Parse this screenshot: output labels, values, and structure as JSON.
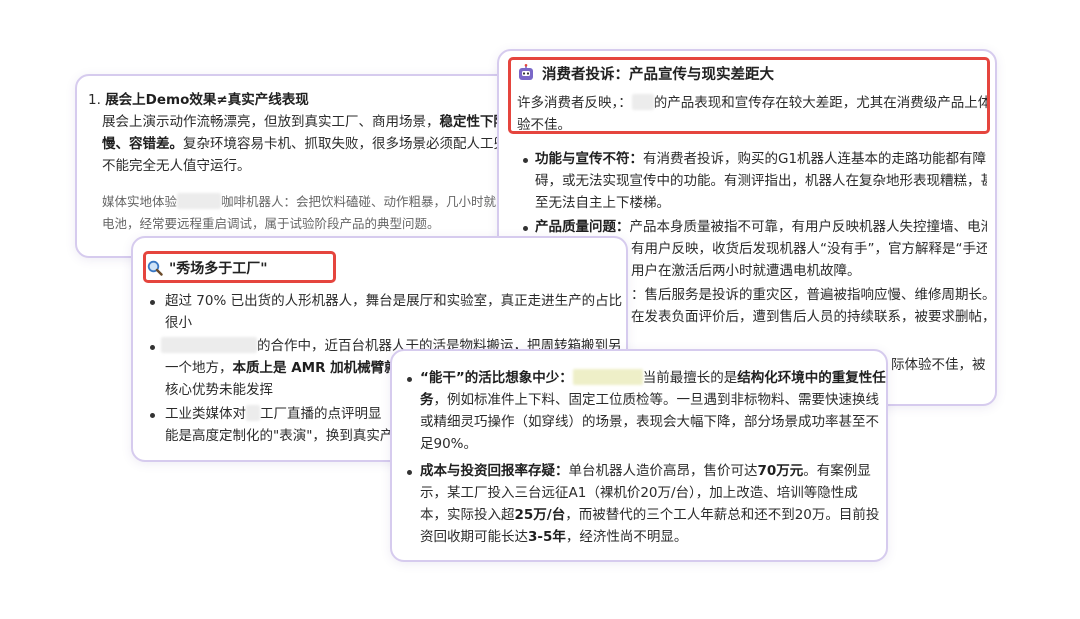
{
  "card1": {
    "num": "1.",
    "title": "展会上Demo效果≠真实产线表现",
    "l1": "展会上演示动作流畅漂亮，但放到真实工厂、商用场景，",
    "l1b": "稳定性下降、",
    "l2b1": "慢、容错差。",
    "l2": "复杂环境容易卡机、抓取失败，很多场景必须配人工兜底",
    "l3": "不能完全无人值守运行。",
    "s1a": "媒体实地体验",
    "s1b": "咖啡机器人：会把饮料磕碰、动作粗暴，几小时就",
    "s2": "电池，经常要远程重启调试，属于试验阶段产品的典型问题。"
  },
  "card2": {
    "icon": "robot-icon",
    "title": "消费者投诉：产品宣传与现实差距大",
    "p1a": "许多消费者反映，：",
    "p1b": "的产品表现和宣传存在较大差距，尤其在消费级产品上体",
    "p2": "验不佳。",
    "b1k": "功能与宣传不符：",
    "b1a": "有消费者投诉，购买的G1机器人连基本的走路功能都有障",
    "b1b": "碍，或无法实现宣传中的功能。有测评指出，机器人在复杂地形表现糟糕，甚",
    "b1c": "至无法自主上下楼梯。",
    "b2k": "产品质量问题：",
    "b2a": "产品本身质量被指不可靠，有用户反映机器人失控撞墙、电池",
    "b2b": "有用户反映，收货后发现机器人“没有手”，官方解释是“手还没",
    "b2c": "用户在激活后两小时就遭遇电机故障。",
    "b3a": "：售后服务是投诉的重灾区，普遍被指响应慢、维修周期长。",
    "b3b": "在发表负面评价后，遭到售后人员的持续联系，被要求删帖，",
    "b4": "际体验不佳，被"
  },
  "card3": {
    "icon": "magnifier-icon",
    "title": "\"秀场多于工厂\"",
    "b1a": "超过 70% 已出货的人形机器人，舞台是展厅和实验室，真正走进生产的占比",
    "b1b": "很小",
    "b2a": "的合作中，近百台机器人干的活是物料搬运，把周转箱搬到另",
    "b2b": "一个地方，",
    "b2k": "本质上是 AMR 加机械臂就能",
    "b2c": "核心优势未能发挥",
    "b3a": "工业类媒体对",
    "b3b": "工厂直播的点评明显",
    "b3c": "能是高度定制化的\"表演\"，换到真实产线"
  },
  "card4": {
    "b1k": "“能干”的活比想象中少：",
    "b1a": "当前最擅长的是",
    "b1k2": "结构化环境中的重复性任",
    "b1k3": "务",
    "b1b": "，例如标准件上下料、固定工位质检等。一旦遇到非标物料、需要快速换线",
    "b1c": "或精细灵巧操作（如穿线）的场景，表现会大幅下降，部分场景成功率甚至不",
    "b1d": "足90%。",
    "b2k": "成本与投资回报率存疑：",
    "b2a": "单台机器人造价高昂，售价可达",
    "b2k2": "70万元",
    "b2a2": "。有案例显",
    "b2b": "示，某工厂投入三台远征A1（裸机价20万/台），加上改造、培训等隐性成",
    "b2c1": "本，实际投入超",
    "b2k3": "25万/台",
    "b2c2": "，而被替代的三个工人年薪总和还不到20万。目前投",
    "b2d1": "资回收期可能长达",
    "b2k4": "3-5年",
    "b2d2": "，经济性尚不明显。"
  }
}
